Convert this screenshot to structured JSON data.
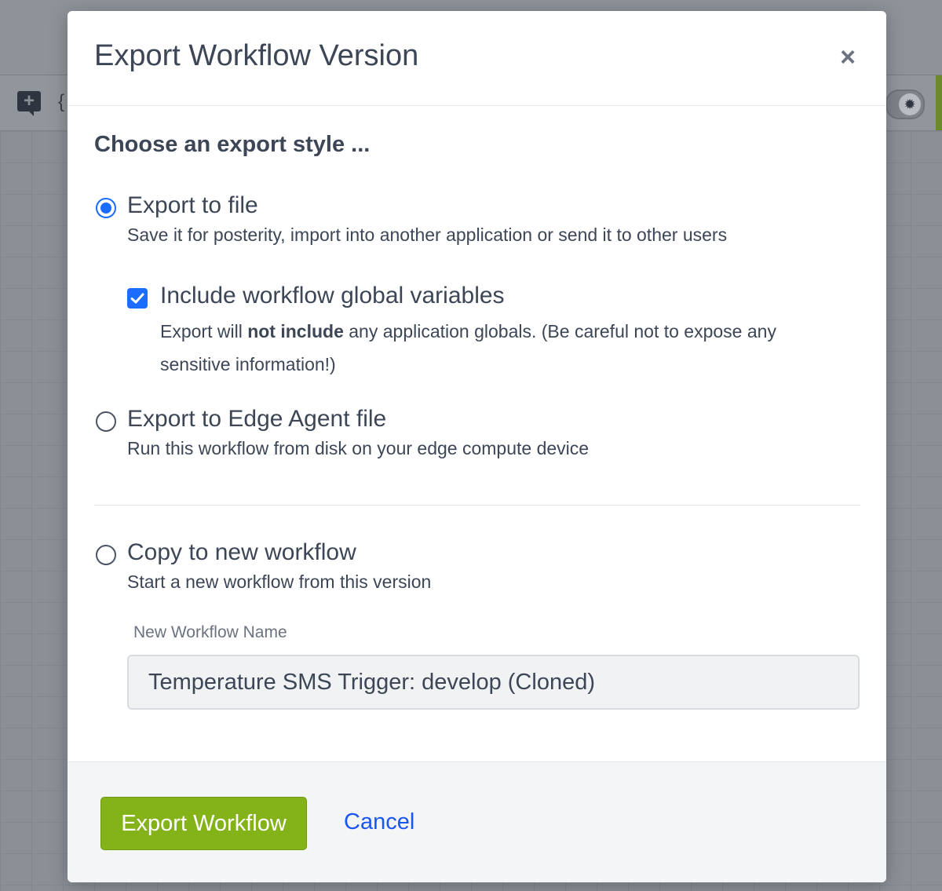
{
  "background": {
    "comment_icon": "comment-add-icon",
    "brace_glyph": "{",
    "toggle_icon": "bug-icon"
  },
  "modal": {
    "title": "Export Workflow Version",
    "close_icon": "close-icon",
    "close_glyph": "×",
    "section_heading": "Choose an export style ...",
    "options": {
      "file": {
        "label": "Export to file",
        "description": "Save it for posterity, import into another application or send it to other users",
        "checked": true
      },
      "include_globals": {
        "label": "Include workflow global variables",
        "desc_before": "Export will ",
        "desc_bold": "not include",
        "desc_after": " any application globals. (Be careful not to expose any sensitive information!)",
        "checked": true
      },
      "edge": {
        "label": "Export to Edge Agent file",
        "description": "Run this workflow from disk on your edge compute device",
        "checked": false
      },
      "copy": {
        "label": "Copy to new workflow",
        "description": "Start a new workflow from this version",
        "checked": false
      }
    },
    "new_workflow_name": {
      "label": "New Workflow Name",
      "value": "Temperature SMS Trigger: develop (Cloned)"
    },
    "footer": {
      "primary_label": "Export Workflow",
      "cancel_label": "Cancel"
    }
  },
  "colors": {
    "accent": "#1a6dff",
    "primary_button": "#84b319",
    "link": "#1a56f0"
  }
}
